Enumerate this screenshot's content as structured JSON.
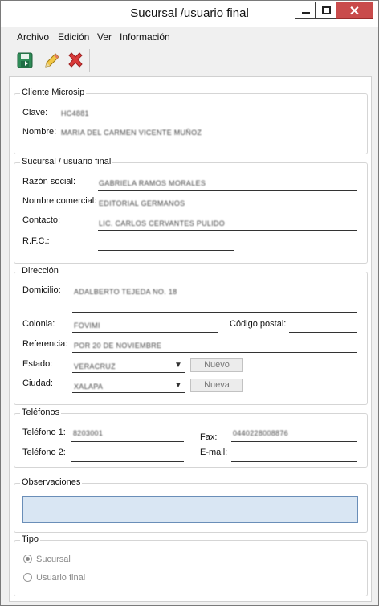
{
  "window": {
    "title": "Sucursal /usuario final"
  },
  "menu": [
    "Archivo",
    "Edición",
    "Ver",
    "Información"
  ],
  "toolbar": {
    "icons": [
      "save-icon",
      "edit-icon",
      "delete-icon"
    ]
  },
  "cliente": {
    "title": "Cliente Microsip",
    "clave_label": "Clave:",
    "clave_value": "HC4881",
    "nombre_label": "Nombre:",
    "nombre_value": "MARIA DEL CARMEN VICENTE MUÑOZ"
  },
  "sucursal": {
    "title": "Sucursal / usuario final",
    "razon_label": "Razón social:",
    "razon_value": "GABRIELA RAMOS MORALES",
    "comercial_label": "Nombre comercial:",
    "comercial_value": "EDITORIAL GERMANOS",
    "contacto_label": "Contacto:",
    "contacto_value": "LIC. CARLOS CERVANTES PULIDO",
    "rfc_label": "R.F.C.:",
    "rfc_value": ""
  },
  "direccion": {
    "title": "Dirección",
    "domicilio_label": "Domicilio:",
    "domicilio_value": "ADALBERTO TEJEDA NO. 18",
    "colonia_label": "Colonia:",
    "colonia_value": "FOVIMI",
    "cp_label": "Código postal:",
    "cp_value": "",
    "referencia_label": "Referencia:",
    "referencia_value": "POR 20 DE NOVIEMBRE",
    "estado_label": "Estado:",
    "estado_value": "VERACRUZ",
    "estado_button": "Nuevo",
    "ciudad_label": "Ciudad:",
    "ciudad_value": "XALAPA",
    "ciudad_button": "Nueva"
  },
  "telefonos": {
    "title": "Teléfonos",
    "tel1_label": "Teléfono 1:",
    "tel1_value": "8203001",
    "fax_label": "Fax:",
    "fax_value": "0440228008876",
    "tel2_label": "Teléfono 2:",
    "tel2_value": "",
    "email_label": "E-mail:",
    "email_value": ""
  },
  "observaciones": {
    "title": "Observaciones",
    "value": ""
  },
  "tipo": {
    "title": "Tipo",
    "options": [
      "Sucursal",
      "Usuario final"
    ],
    "selected": "Sucursal"
  }
}
